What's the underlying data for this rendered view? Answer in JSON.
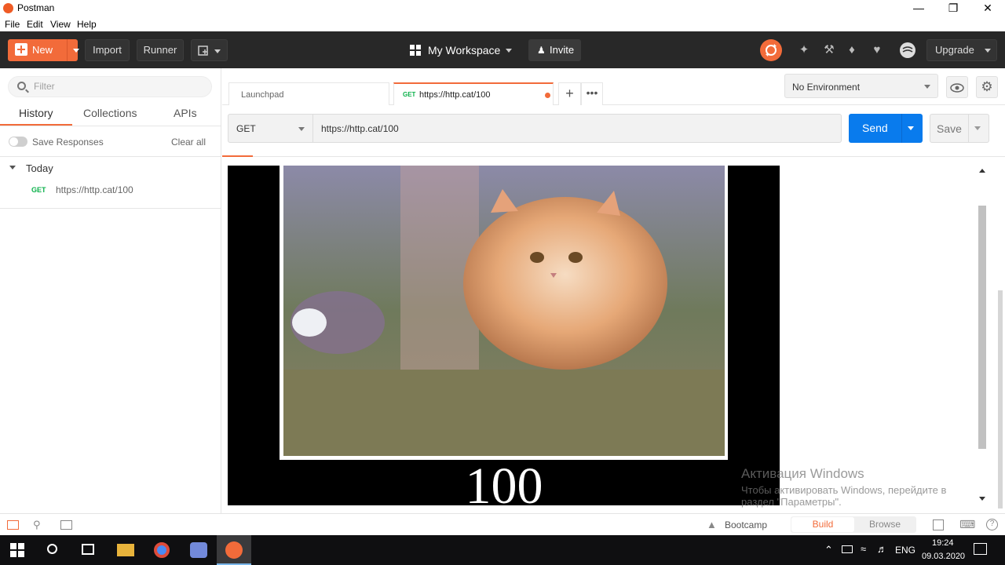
{
  "window": {
    "title": "Postman"
  },
  "menu": [
    "File",
    "Edit",
    "View",
    "Help"
  ],
  "header": {
    "new_label": "New",
    "import_label": "Import",
    "runner_label": "Runner",
    "workspace_label": "My Workspace",
    "invite_label": "Invite",
    "upgrade_label": "Upgrade"
  },
  "sidebar": {
    "filter_placeholder": "Filter",
    "tabs": [
      "History",
      "Collections",
      "APIs"
    ],
    "active_tab": "History",
    "save_responses_label": "Save Responses",
    "clear_all_label": "Clear all",
    "group_label": "Today",
    "history_items": [
      {
        "method": "GET",
        "url": "https://http.cat/100"
      }
    ]
  },
  "tabs": [
    {
      "label": "Launchpad"
    },
    {
      "method": "GET",
      "label": "https://http.cat/100",
      "unsaved": true
    }
  ],
  "environment": {
    "selected": "No Environment"
  },
  "request": {
    "method": "GET",
    "url": "https://http.cat/100",
    "send_label": "Send",
    "save_label": "Save"
  },
  "response": {
    "status_caption": "100"
  },
  "watermark": {
    "title": "Активация Windows",
    "line1": "Чтобы активировать Windows, перейдите в",
    "line2": "раздел \"Параметры\"."
  },
  "statusbar": {
    "bootcamp_label": "Bootcamp",
    "build_label": "Build",
    "browse_label": "Browse"
  },
  "taskbar": {
    "lang": "ENG",
    "time": "19:24",
    "date": "09.03.2020"
  },
  "colors": {
    "accent": "#f26b3a",
    "send_blue": "#097bed",
    "header_bg": "#282828",
    "get_green": "#0cb14b"
  }
}
